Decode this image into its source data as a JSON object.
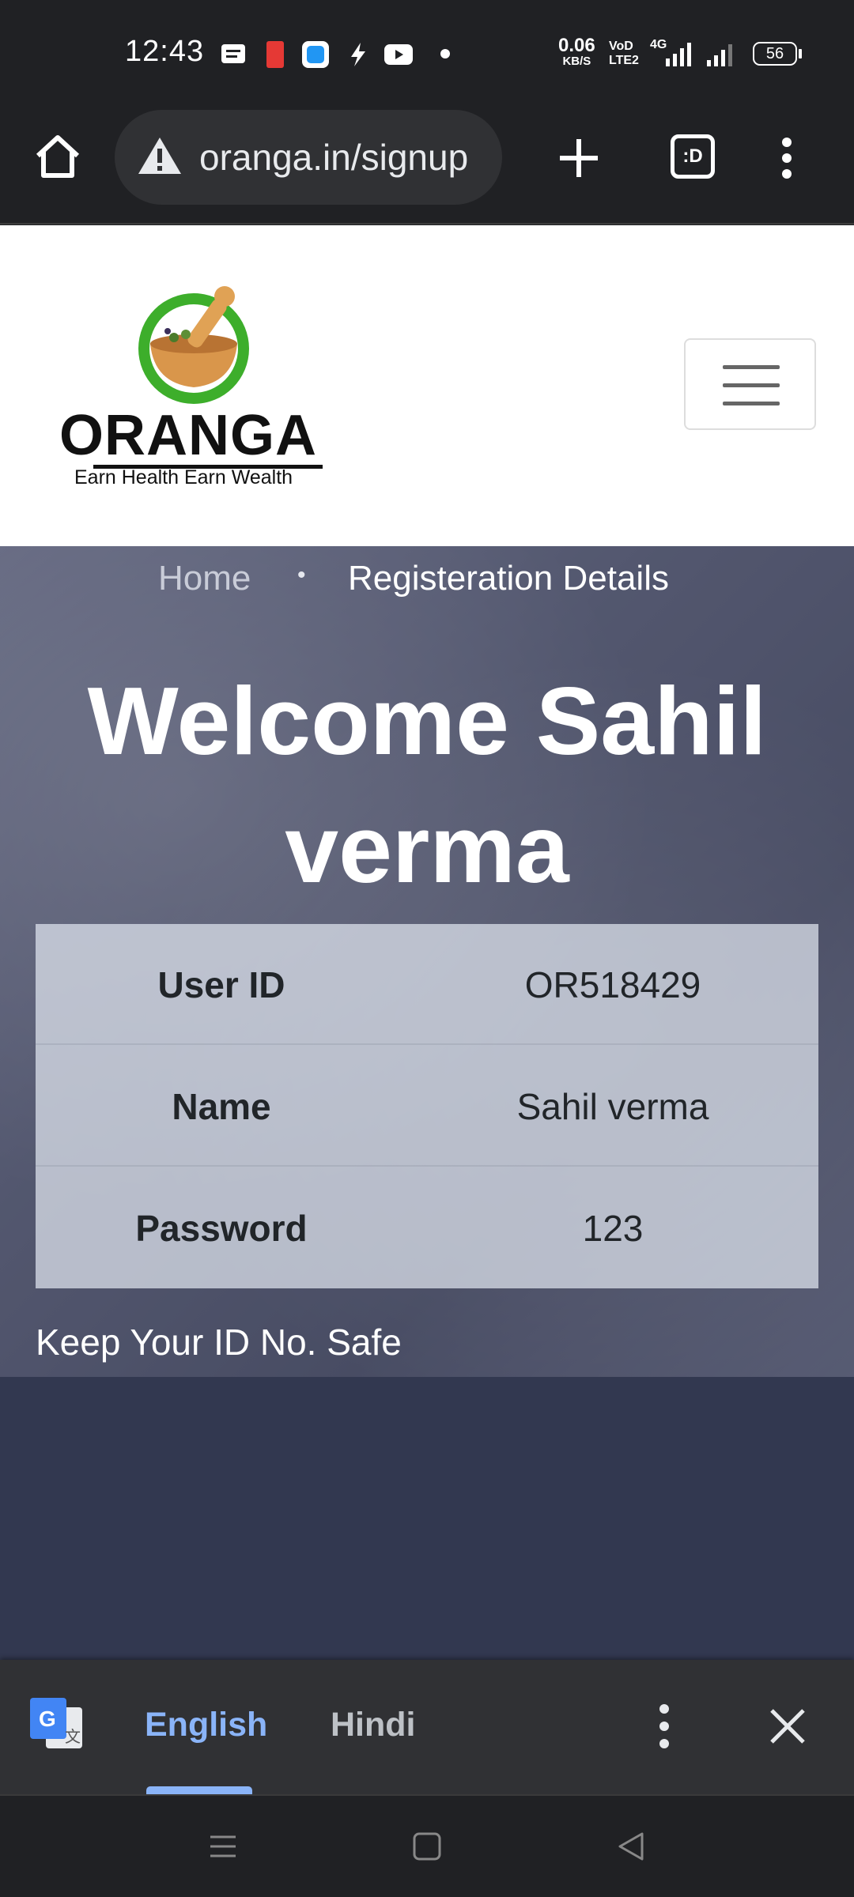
{
  "status": {
    "time": "12:43",
    "speed_value": "0.06",
    "speed_unit": "KB/S",
    "volte_top": "VoD",
    "volte_bottom": "LTE2",
    "network": "4G",
    "battery": "56"
  },
  "browser": {
    "url": "oranga.in/signup",
    "tab_label": ":D"
  },
  "logo": {
    "brand": "ORANGA",
    "tagline": "Earn Health Earn Wealth"
  },
  "breadcrumb": {
    "home": "Home",
    "separator": "•",
    "current": "Registeration Details"
  },
  "welcome": {
    "line1": "Welcome Sahil",
    "line2": "verma"
  },
  "details": [
    {
      "label": "User ID",
      "value": "OR518429"
    },
    {
      "label": "Name",
      "value": "Sahil verma"
    },
    {
      "label": "Password",
      "value": "123"
    }
  ],
  "note": "Keep Your ID No. Safe",
  "translate": {
    "lang1": "English",
    "lang2": "Hindi"
  },
  "colors": {
    "brand_green": "#3dae2b",
    "hero_overlay": "#3c405c",
    "footer": "#323850",
    "active_lang": "#8ab4f8"
  }
}
